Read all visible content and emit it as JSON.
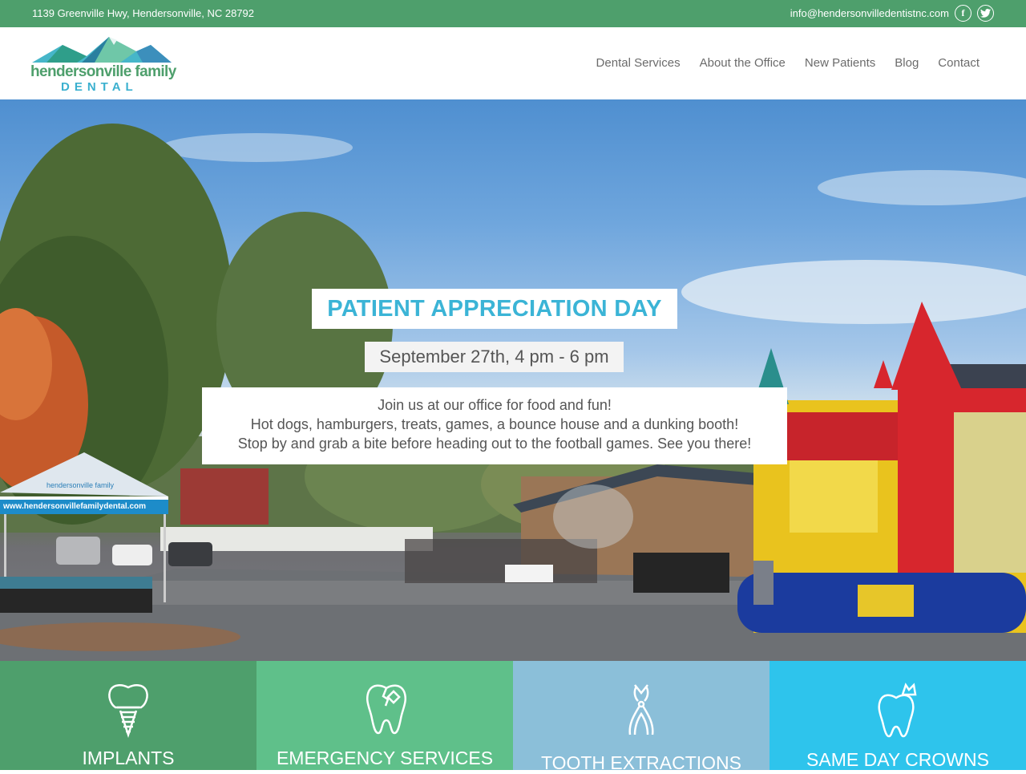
{
  "topbar": {
    "address": "1139 Greenville Hwy, Hendersonville, NC 28792",
    "email": "info@hendersonvilledentistnc.com",
    "facebook_glyph": "f",
    "twitter_glyph": "t"
  },
  "logo": {
    "name": "hendersonville family",
    "sub": "DENTAL"
  },
  "nav": {
    "items": [
      "Dental Services",
      "About the Office",
      "New Patients",
      "Blog",
      "Contact"
    ]
  },
  "hero": {
    "title": "PATIENT APPRECIATION DAY",
    "date": "September 27th, 4 pm - 6 pm",
    "lines": [
      "Join us at our office for food and fun!",
      "Hot dogs, hamburgers, treats, games, a bounce house and a dunking booth!",
      "Stop by and grab a bite before heading out to the football games. See you there!"
    ],
    "tent_brand": "hendersonville family",
    "tent_url": "www.hendersonvillefamilydental.com"
  },
  "tiles": [
    {
      "label": "IMPLANTS",
      "color": "#4e9f6c",
      "icon": "implant-icon"
    },
    {
      "label": "EMERGENCY SERVICES",
      "color": "#5fc08a",
      "icon": "broken-tooth-icon"
    },
    {
      "label": "TOOTH EXTRACTIONS",
      "color": "#8bbfd9",
      "icon": "forceps-icon"
    },
    {
      "label": "SAME DAY CROWNS",
      "color": "#2ec4ec",
      "icon": "crown-tooth-icon"
    }
  ]
}
